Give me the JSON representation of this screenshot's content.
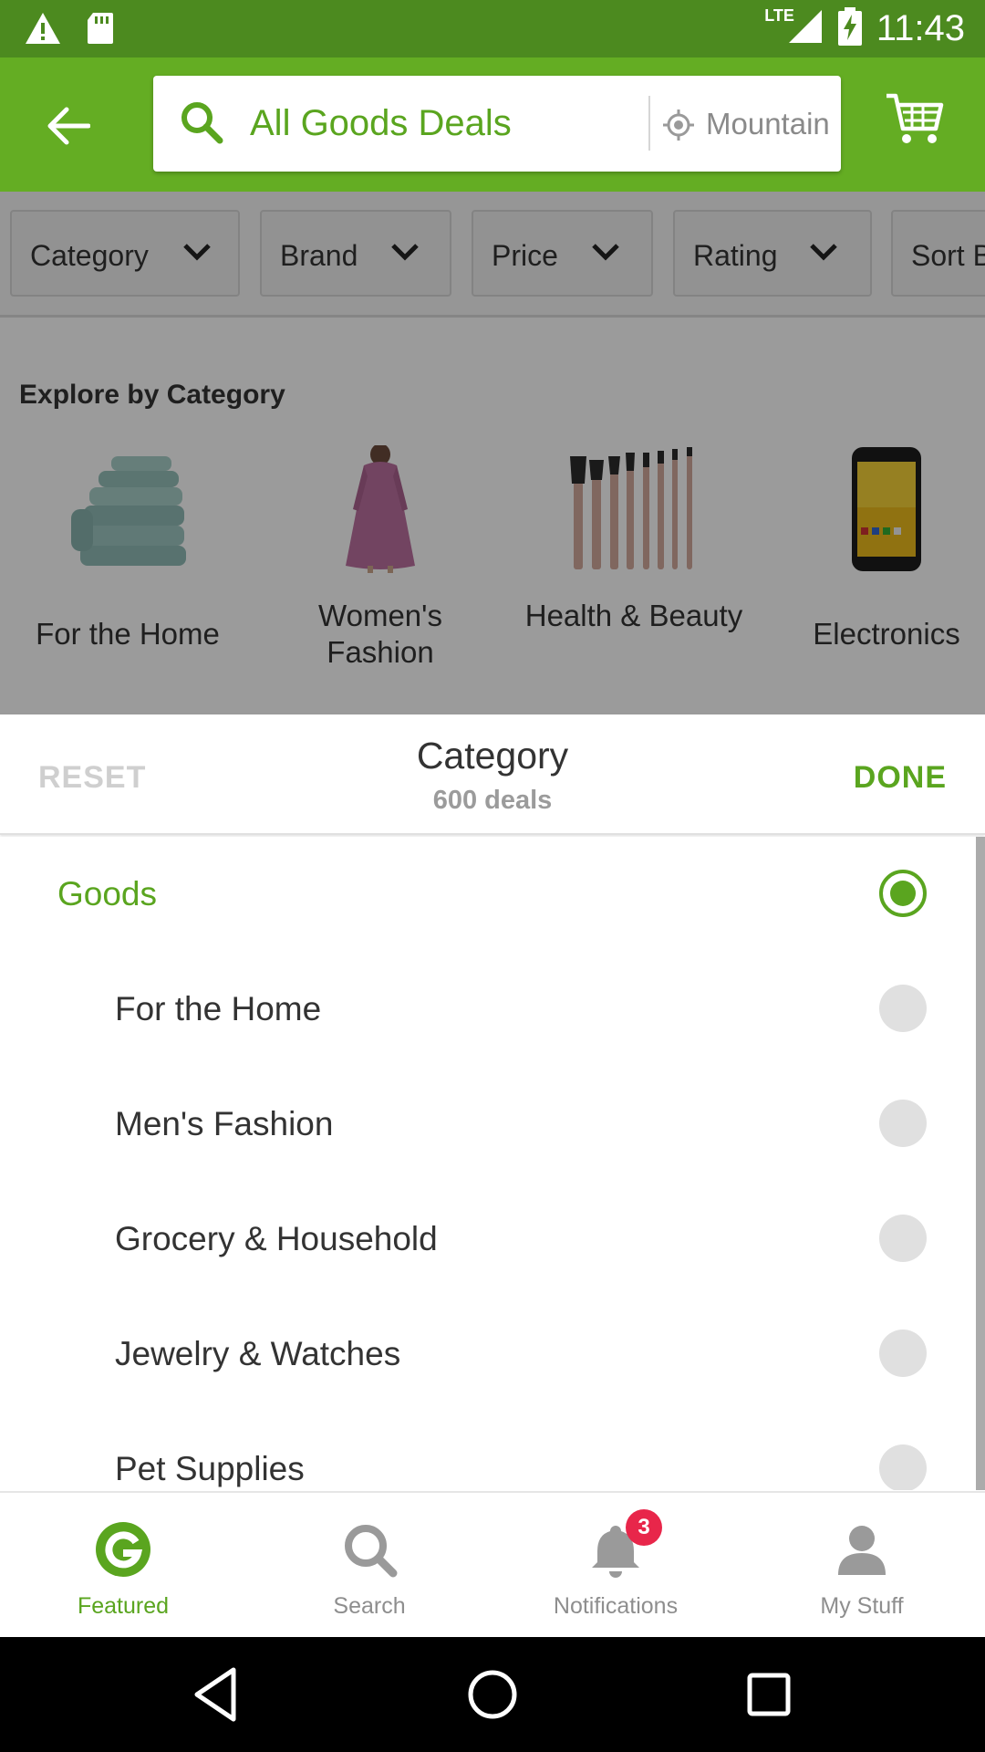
{
  "status_bar": {
    "time": "11:43",
    "network": "LTE",
    "icons": [
      "warning-icon",
      "sd-card-icon",
      "signal-icon",
      "battery-charging-icon"
    ]
  },
  "app_bar": {
    "search_text": "All Goods Deals",
    "location_text": "Mountain View",
    "icons": [
      "back-arrow-icon",
      "search-icon",
      "location-icon",
      "cart-icon"
    ]
  },
  "filters": [
    {
      "label": "Category"
    },
    {
      "label": "Brand"
    },
    {
      "label": "Price"
    },
    {
      "label": "Rating"
    },
    {
      "label": "Sort By"
    }
  ],
  "explore": {
    "title": "Explore by Category",
    "categories": [
      {
        "label": "For the Home",
        "icon": "towels-image"
      },
      {
        "label": "Women's Fashion",
        "icon": "dress-image"
      },
      {
        "label": "Health & Beauty",
        "icon": "makeup-brushes-image"
      },
      {
        "label": "Electronics",
        "icon": "smartphone-image"
      }
    ]
  },
  "sheet": {
    "reset_label": "RESET",
    "title": "Category",
    "subtitle": "600 deals",
    "done_label": "DONE"
  },
  "options": [
    {
      "label": "Goods",
      "selected": true
    },
    {
      "label": "For the Home",
      "selected": false
    },
    {
      "label": "Men's Fashion",
      "selected": false
    },
    {
      "label": "Grocery & Household",
      "selected": false
    },
    {
      "label": "Jewelry & Watches",
      "selected": false
    },
    {
      "label": "Pet Supplies",
      "selected": false
    }
  ],
  "bottom_nav": [
    {
      "label": "Featured",
      "icon": "groupon-g-icon",
      "active": true
    },
    {
      "label": "Search",
      "icon": "search-icon",
      "active": false
    },
    {
      "label": "Notifications",
      "icon": "bell-icon",
      "active": false,
      "badge": "3"
    },
    {
      "label": "My Stuff",
      "icon": "person-icon",
      "active": false
    }
  ],
  "colors": {
    "brand_green": "#64ad23",
    "status_green": "#4c8a1f",
    "accent_green": "#5aa51f",
    "badge_red": "#e8264a"
  }
}
